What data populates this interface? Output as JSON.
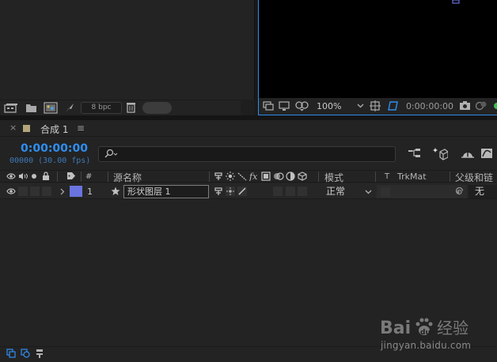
{
  "project": {
    "bpc_label": "8 bpc"
  },
  "viewer": {
    "zoom": "100%",
    "timecode": "0:00:00:00"
  },
  "timeline": {
    "tab": {
      "close": "×",
      "label": "合成 1",
      "menu": "≡"
    },
    "timecode": "0:00:00:00",
    "frames": "00000 (30.00 fps)",
    "columns": {
      "number": "#",
      "source_name": "源名称",
      "mode": "模式",
      "t": "T",
      "trkmat": "TrkMat",
      "parent": "父级和链"
    },
    "layers": [
      {
        "number": "1",
        "name": "形状图层 1",
        "mode": "正常",
        "parent": "无",
        "label_color": "#6a74e0"
      }
    ]
  },
  "watermark": {
    "url": "jingyan.baidu.com"
  },
  "colors": {
    "accent_blue": "#2f8ef0",
    "panel_bg": "#232323",
    "viewer_canvas": "#000000"
  }
}
